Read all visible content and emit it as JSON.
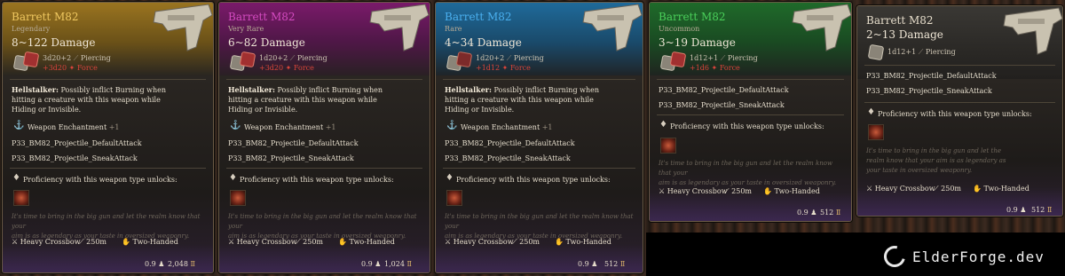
{
  "cards": [
    {
      "name": "Barrett M82",
      "rarity": "Legendary",
      "damage": "8~122 Damage",
      "dice": "3d20+2",
      "dice_type": "Piercing",
      "bonus": "+3d20",
      "bonus_type": "Force",
      "passive_name": "Hellstalker:",
      "passive_line1": " Possibly inflict Burning when",
      "passive_line2": "hitting a creature with this weapon while",
      "passive_line3": "Hiding or Invisible.",
      "enchant_label": "Weapon Enchantment",
      "enchant_value": "+1",
      "action1": "P33_BM82_Projectile_DefaultAttack",
      "action2": "P33_BM82_Projectile_SneakAttack",
      "proficiency": "Proficiency with this weapon type unlocks:",
      "flavor_line1": "It's time to bring in the big gun and let the realm know that your",
      "flavor_line2": "aim is as legendary as your taste in oversized weaponry.",
      "weapon_type": "Heavy Crossbow",
      "range": "250m",
      "handed": "Two-Handed",
      "weight": "0.9",
      "price": "2,048",
      "color": "#c89a2a"
    },
    {
      "name": "Barrett M82",
      "rarity": "Very Rare",
      "damage": "6~82 Damage",
      "dice": "1d20+2",
      "dice_type": "Piercing",
      "bonus": "+3d20",
      "bonus_type": "Force",
      "passive_name": "Hellstalker:",
      "passive_line1": " Possibly inflict Burning when",
      "passive_line2": "hitting a creature with this weapon while",
      "passive_line3": "Hiding or Invisible.",
      "enchant_label": "Weapon Enchantment",
      "enchant_value": "+1",
      "action1": "P33_BM82_Projectile_DefaultAttack",
      "action2": "P33_BM82_Projectile_SneakAttack",
      "proficiency": "Proficiency with this weapon type unlocks:",
      "flavor_line1": "It's time to bring in the big gun and let the realm know that your",
      "flavor_line2": "aim is as legendary as your taste in oversized weaponry.",
      "weapon_type": "Heavy Crossbow",
      "range": "250m",
      "handed": "Two-Handed",
      "weight": "0.9",
      "price": "1,024",
      "color": "#9a2a8a"
    },
    {
      "name": "Barrett M82",
      "rarity": "Rare",
      "damage": "4~34 Damage",
      "dice": "1d20+2",
      "dice_type": "Piercing",
      "bonus": "+1d12",
      "bonus_type": "Force",
      "passive_name": "Hellstalker:",
      "passive_line1": " Possibly inflict Burning when",
      "passive_line2": "hitting a creature with this weapon while",
      "passive_line3": "Hiding or Invisible.",
      "enchant_label": "Weapon Enchantment",
      "enchant_value": "+1",
      "action1": "P33_BM82_Projectile_DefaultAttack",
      "action2": "P33_BM82_Projectile_SneakAttack",
      "proficiency": "Proficiency with this weapon type unlocks:",
      "flavor_line1": "It's time to bring in the big gun and let the realm know that your",
      "flavor_line2": "aim is as legendary as your taste in oversized weaponry.",
      "weapon_type": "Heavy Crossbow",
      "range": "250m",
      "handed": "Two-Handed",
      "weight": "0.9",
      "price": "512",
      "color": "#2a7ab8"
    },
    {
      "name": "Barrett M82",
      "rarity": "Uncommon",
      "damage": "3~19 Damage",
      "dice": "1d12+1",
      "dice_type": "Piercing",
      "bonus": "+1d6",
      "bonus_type": "Force",
      "action1": "P33_BM82_Projectile_DefaultAttack",
      "action2": "P33_BM82_Projectile_SneakAttack",
      "proficiency": "Proficiency with this weapon type unlocks:",
      "flavor_line1": "It's time to bring in the big gun and let the realm know that your",
      "flavor_line2": "aim is as legendary as your taste in oversized weaponry.",
      "weapon_type": "Heavy Crossbow",
      "range": "250m",
      "handed": "Two-Handed",
      "weight": "0.9",
      "price": "512",
      "color": "#2e8a3a"
    },
    {
      "name": "Barrett M82",
      "damage": "2~13 Damage",
      "dice": "1d12+1",
      "dice_type": "Piercing",
      "action1": "P33_BM82_Projectile_DefaultAttack",
      "action2": "P33_BM82_Projectile_SneakAttack",
      "proficiency": "Proficiency with this weapon type unlocks:",
      "flavor_line1": "It's time to bring in the big gun and let the",
      "flavor_line2": "realm know that your aim is as legendary as",
      "flavor_line3": "your taste in oversized weaponry.",
      "weapon_type": "Heavy Crossbow",
      "range": "250m",
      "handed": "Two-Handed",
      "weight": "0.9",
      "price": "512",
      "color": "#5a5650"
    }
  ],
  "watermark": {
    "text": "ElderForge.dev"
  },
  "icons": {
    "dice": "dice-icon",
    "weight": "weight-icon",
    "coin": "coin-icon",
    "crossbow": "crossbow-icon",
    "range": "range-icon",
    "hand": "two-handed-icon",
    "enchant": "enchantment-icon",
    "proficiency": "proficiency-icon"
  }
}
